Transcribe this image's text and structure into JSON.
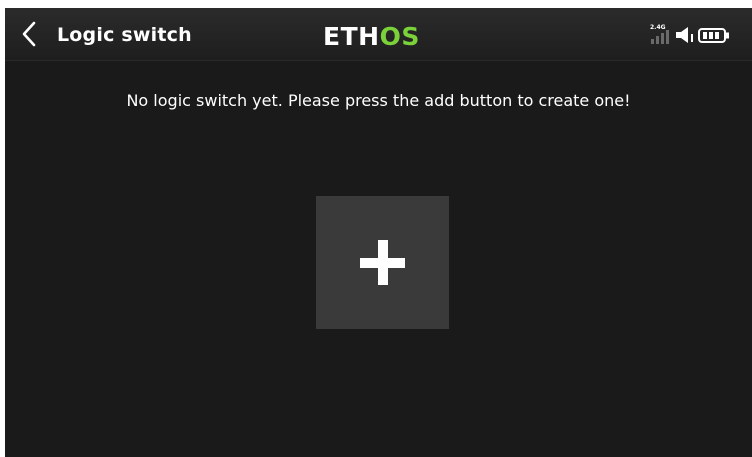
{
  "header": {
    "back_icon": "chevron-left-icon",
    "title": "Logic switch",
    "logo": {
      "part1": "ETH",
      "part2": "OS"
    },
    "status": {
      "band_label": "2.4G",
      "signal_icon": "signal-bars-icon",
      "speaker_icon": "speaker-icon",
      "battery_icon": "battery-icon"
    }
  },
  "main": {
    "empty_message": "No logic switch yet. Please press the add button to create one!",
    "add_button_icon": "plus-icon"
  },
  "colors": {
    "background": "#1a1a1a",
    "header": "#262626",
    "add_button": "#3a3a3a",
    "logo_accent": "#7bd13a",
    "text": "#ffffff"
  }
}
